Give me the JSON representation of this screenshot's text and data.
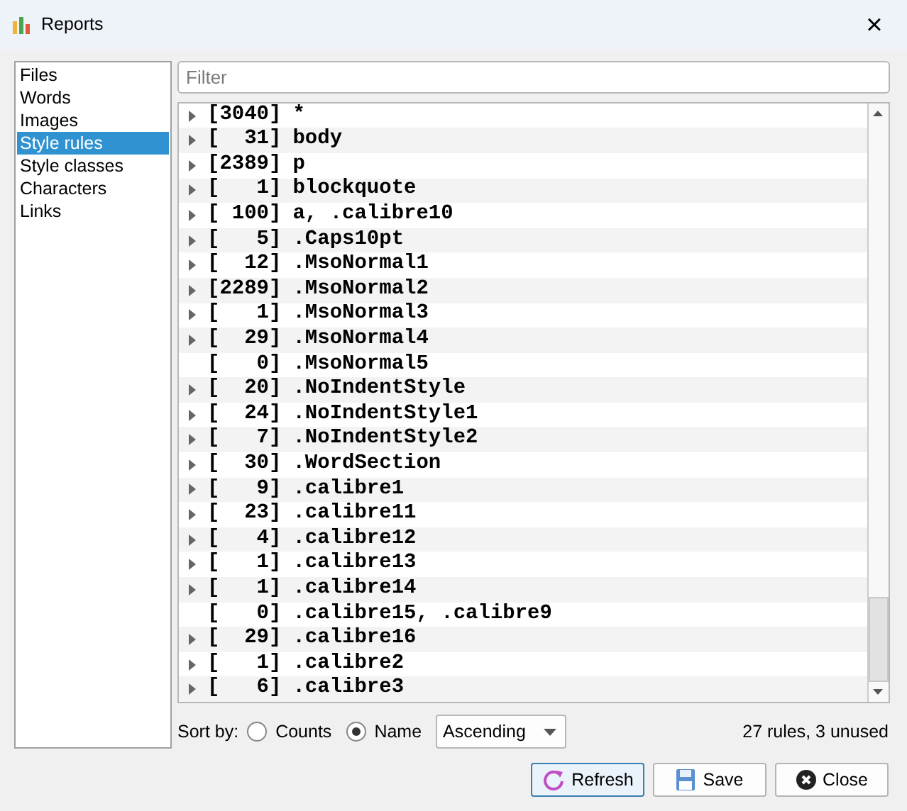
{
  "window": {
    "title": "Reports",
    "close": "×"
  },
  "sidebar": {
    "items": [
      {
        "label": "Files",
        "selected": false
      },
      {
        "label": "Words",
        "selected": false
      },
      {
        "label": "Images",
        "selected": false
      },
      {
        "label": "Style rules",
        "selected": true
      },
      {
        "label": "Style classes",
        "selected": false
      },
      {
        "label": "Characters",
        "selected": false
      },
      {
        "label": "Links",
        "selected": false
      }
    ]
  },
  "filter": {
    "placeholder": "Filter"
  },
  "tree": {
    "rows": [
      {
        "count": "[3040]",
        "selector": "*",
        "expandable": true
      },
      {
        "count": "[  31]",
        "selector": "body",
        "expandable": true
      },
      {
        "count": "[2389]",
        "selector": "p",
        "expandable": true
      },
      {
        "count": "[   1]",
        "selector": "blockquote",
        "expandable": true
      },
      {
        "count": "[ 100]",
        "selector": "a, .calibre10",
        "expandable": true
      },
      {
        "count": "[   5]",
        "selector": ".Caps10pt",
        "expandable": true
      },
      {
        "count": "[  12]",
        "selector": ".MsoNormal1",
        "expandable": true
      },
      {
        "count": "[2289]",
        "selector": ".MsoNormal2",
        "expandable": true
      },
      {
        "count": "[   1]",
        "selector": ".MsoNormal3",
        "expandable": true
      },
      {
        "count": "[  29]",
        "selector": ".MsoNormal4",
        "expandable": true
      },
      {
        "count": "[   0]",
        "selector": ".MsoNormal5",
        "expandable": false
      },
      {
        "count": "[  20]",
        "selector": ".NoIndentStyle",
        "expandable": true
      },
      {
        "count": "[  24]",
        "selector": ".NoIndentStyle1",
        "expandable": true
      },
      {
        "count": "[   7]",
        "selector": ".NoIndentStyle2",
        "expandable": true
      },
      {
        "count": "[  30]",
        "selector": ".WordSection",
        "expandable": true
      },
      {
        "count": "[   9]",
        "selector": ".calibre1",
        "expandable": true
      },
      {
        "count": "[  23]",
        "selector": ".calibre11",
        "expandable": true
      },
      {
        "count": "[   4]",
        "selector": ".calibre12",
        "expandable": true
      },
      {
        "count": "[   1]",
        "selector": ".calibre13",
        "expandable": true
      },
      {
        "count": "[   1]",
        "selector": ".calibre14",
        "expandable": true
      },
      {
        "count": "[   0]",
        "selector": ".calibre15, .calibre9",
        "expandable": false
      },
      {
        "count": "[  29]",
        "selector": ".calibre16",
        "expandable": true
      },
      {
        "count": "[   1]",
        "selector": ".calibre2",
        "expandable": true
      },
      {
        "count": "[   6]",
        "selector": ".calibre3",
        "expandable": true
      }
    ]
  },
  "sort": {
    "label": "Sort by:",
    "options": [
      {
        "label": "Counts",
        "selected": false
      },
      {
        "label": "Name",
        "selected": true
      }
    ],
    "order": "Ascending"
  },
  "summary": "27 rules, 3 unused",
  "buttons": [
    {
      "label": "Refresh",
      "kind": "refresh",
      "default": true
    },
    {
      "label": "Save",
      "kind": "save",
      "default": false
    },
    {
      "label": "Close",
      "kind": "close",
      "default": false
    }
  ]
}
